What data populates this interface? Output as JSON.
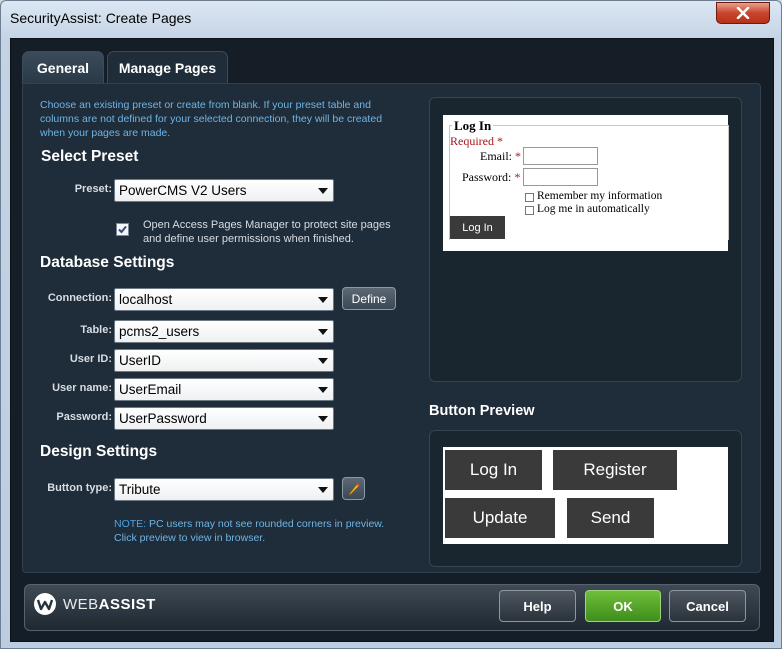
{
  "window": {
    "title": "SecurityAssist: Create Pages",
    "close_icon": "close-icon"
  },
  "tabs": [
    {
      "label": "General"
    },
    {
      "label": "Manage Pages"
    }
  ],
  "intro": "Choose an existing preset or create from blank. If your preset table and columns are not defined for your selected connection, they will be created when your pages are made.",
  "select_preset": {
    "title": "Select Preset",
    "preset_label": "Preset:",
    "preset_value": "PowerCMS V2 Users",
    "checkbox_checked": true,
    "checkbox_text": "Open Access Pages Manager to protect site pages and define user permissions when finished."
  },
  "database": {
    "title": "Database Settings",
    "connection_label": "Connection:",
    "connection_value": "localhost",
    "define_label": "Define",
    "table_label": "Table:",
    "table_value": "pcms2_users",
    "userid_label": "User ID:",
    "userid_value": "UserID",
    "username_label": "User name:",
    "username_value": "UserEmail",
    "password_label": "Password:",
    "password_value": "UserPassword"
  },
  "design": {
    "title": "Design Settings",
    "button_type_label": "Button type:",
    "button_type_value": "Tribute",
    "edit_icon": "pencil-icon",
    "note_prefix": "NOTE:",
    "note_text": " PC users may not see rounded corners in preview. Click preview to view in browser."
  },
  "login_preview": {
    "legend": "Log In",
    "required": "Required",
    "asterisk": "*",
    "email_label": "Email:",
    "password_label": "Password:",
    "remember": "Remember my information",
    "auto": "Log me in automatically",
    "login_button": "Log In"
  },
  "button_preview": {
    "title": "Button Preview",
    "buttons": [
      "Log In",
      "Register",
      "Update",
      "Send"
    ]
  },
  "footer": {
    "logo_web": "WEB",
    "logo_assist": "ASSIST",
    "help": "Help",
    "ok": "OK",
    "cancel": "Cancel",
    "colors": {
      "ok_green": "#4c9e24",
      "panel": "#1f2c39",
      "link_blue": "#6fb5e4"
    }
  }
}
